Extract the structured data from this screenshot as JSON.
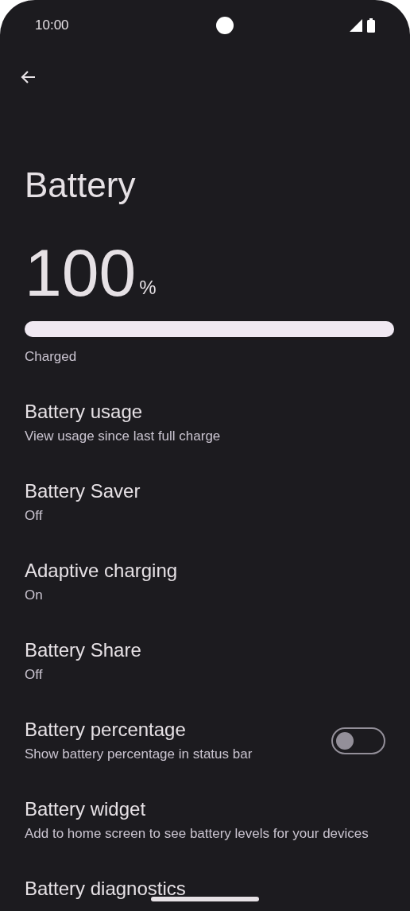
{
  "status_bar": {
    "time": "10:00"
  },
  "title": "Battery",
  "battery": {
    "percent": "100",
    "unit": "%",
    "level": 1,
    "status": "Charged"
  },
  "items": [
    {
      "kind": "text",
      "title": "Battery usage",
      "subtitle": "View usage since last full charge"
    },
    {
      "kind": "text",
      "title": "Battery Saver",
      "subtitle": "Off"
    },
    {
      "kind": "text",
      "title": "Adaptive charging",
      "subtitle": "On"
    },
    {
      "kind": "text",
      "title": "Battery Share",
      "subtitle": "Off"
    },
    {
      "kind": "toggle",
      "title": "Battery percentage",
      "subtitle": "Show battery percentage in status bar",
      "on": false
    },
    {
      "kind": "text",
      "title": "Battery widget",
      "subtitle": "Add to home screen to see battery levels for your devices"
    },
    {
      "kind": "text",
      "title": "Battery diagnostics"
    }
  ]
}
